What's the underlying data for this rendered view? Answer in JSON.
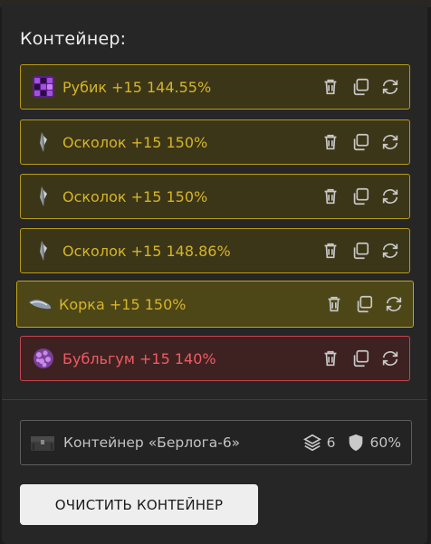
{
  "container": {
    "title": "Контейнер:",
    "items": [
      {
        "label": "Рубик +15 144.55%",
        "icon": "rubik-cube-icon",
        "status": "normal"
      },
      {
        "label": "Осколок +15 150%",
        "icon": "shard-icon",
        "status": "normal"
      },
      {
        "label": "Осколок +15 150%",
        "icon": "shard-icon",
        "status": "normal"
      },
      {
        "label": "Осколок +15 148.86%",
        "icon": "shard-icon",
        "status": "normal"
      },
      {
        "label": "Корка +15 150%",
        "icon": "crust-icon",
        "status": "selected"
      },
      {
        "label": "Бубльгум +15 140%",
        "icon": "bubblegum-icon",
        "status": "danger"
      }
    ]
  },
  "box": {
    "name": "Контейнер «Берлога-6»",
    "layers": "6",
    "protection": "60%"
  },
  "buttons": {
    "clear": "ОЧИСТИТЬ КОНТЕЙНЕР"
  },
  "colors": {
    "item_text": "#d4b52a",
    "item_border": "#b59a16",
    "danger_text": "#ef5b63",
    "danger_border": "#c4454d"
  }
}
